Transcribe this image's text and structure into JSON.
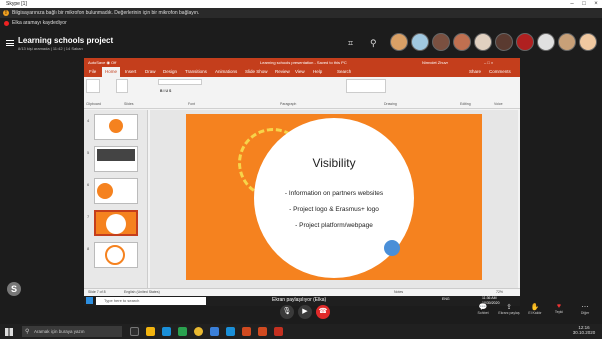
{
  "window": {
    "title": "Skype [1]"
  },
  "notifications": {
    "warning": "Bilgisayarınıza bağlı bir mikrofon bulunmadık. Değerlerinin için bir mikrofon bağlayın.",
    "recording": "Elka aramayı kaydediyor"
  },
  "call": {
    "title": "Learning schools project",
    "subtitle": "8/13 kişi aramada | 11:42 | 14 Sakarı"
  },
  "avatars": [
    "#d9a066",
    "#a0c8e0",
    "#7a5040",
    "#c07050",
    "#e0d0c0",
    "#5a3a30",
    "#b02020",
    "#e0e0e0",
    "#c8a078",
    "#f0c8a0"
  ],
  "ppt": {
    "title": "Learning schools presentation - Saved to this PC",
    "user": "Nimvdet Zhuvr",
    "tabs": [
      "File",
      "Home",
      "Insert",
      "Draw",
      "Design",
      "Transitions",
      "Animations",
      "Slide Show",
      "Review",
      "View",
      "Help",
      "Search"
    ],
    "share": "Share",
    "comments": "Comments",
    "groups": [
      "Clipboard",
      "Slides",
      "Font",
      "Paragraph",
      "Drawing",
      "Editing",
      "Voice"
    ],
    "slide_numbers": [
      "4",
      "5",
      "6",
      "7",
      "8"
    ],
    "slide": {
      "heading": "Visibility",
      "bullets": [
        "- Information on partners websites",
        "- Project logo & Erasmus+ logo",
        "- Project platform/webpage"
      ]
    },
    "status": "Slide 7 of 8",
    "language": "English (United States)",
    "notes": "Notes",
    "zoom": "72%",
    "taskbar_search": "Type here to search",
    "taskbar_time": "11:36 AM",
    "taskbar_date": "10/30/2020",
    "taskbar_lang": "ENG"
  },
  "screen_share_label": "Ekran paylaşılıyor (Elka)",
  "side_actions": [
    {
      "icon": "chat",
      "label": "Sohbet"
    },
    {
      "icon": "share",
      "label": "Ekranı paylaş"
    },
    {
      "icon": "raise",
      "label": "El Kaldır"
    },
    {
      "icon": "heart",
      "label": "Tepki"
    },
    {
      "icon": "more",
      "label": "Diğer"
    }
  ],
  "taskbar": {
    "search_placeholder": "Aramak için buraya yazın",
    "time": "12:16",
    "date": "30.10.2020"
  }
}
